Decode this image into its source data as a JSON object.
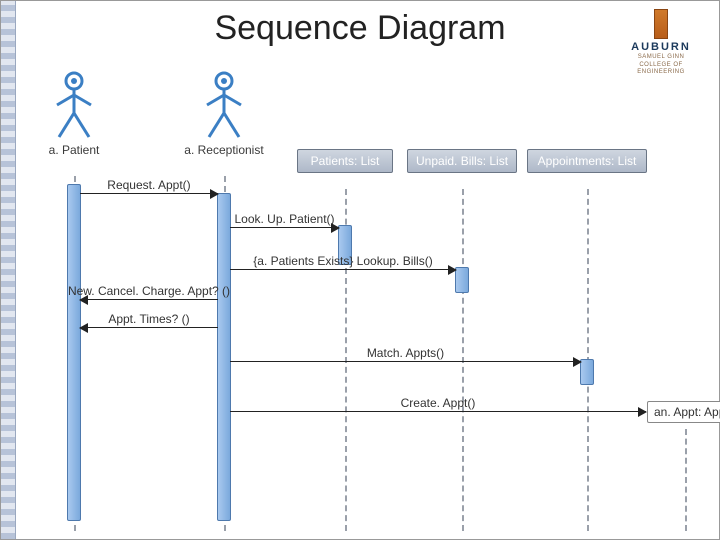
{
  "title": "Sequence Diagram",
  "logo": {
    "name": "AUBURN",
    "sub1": "SAMUEL GINN",
    "sub2": "COLLEGE OF ENGINEERING"
  },
  "actors": {
    "patient": "a. Patient",
    "receptionist": "a. Receptionist"
  },
  "objects": {
    "patients": "Patients: List",
    "bills": "Unpaid. Bills: List",
    "appts": "Appointments: List",
    "newappt": "an. Appt: Appointment"
  },
  "messages": {
    "m1": "Request. Appt()",
    "m2": "Look. Up. Patient()",
    "m3": "{a. Patients Exists} Lookup. Bills()",
    "m4": "New. Cancel. Charge. Appt? ()",
    "m5": "Appt. Times? ()",
    "m6": "Match. Appts()",
    "m7": "Create. Appt()"
  },
  "chart_data": {
    "type": "uml-sequence",
    "participants": [
      {
        "id": "patient",
        "kind": "actor",
        "label": "a. Patient"
      },
      {
        "id": "receptionist",
        "kind": "actor",
        "label": "a. Receptionist"
      },
      {
        "id": "patients",
        "kind": "object",
        "label": "Patients: List"
      },
      {
        "id": "bills",
        "kind": "object",
        "label": "Unpaid. Bills: List"
      },
      {
        "id": "appts",
        "kind": "object",
        "label": "Appointments: List"
      },
      {
        "id": "newappt",
        "kind": "object",
        "label": "an. Appt: Appointment",
        "created_by": "m7"
      }
    ],
    "messages": [
      {
        "id": "m1",
        "from": "patient",
        "to": "receptionist",
        "label": "Request. Appt()",
        "direction": "call"
      },
      {
        "id": "m2",
        "from": "receptionist",
        "to": "patients",
        "label": "Look. Up. Patient()",
        "direction": "call"
      },
      {
        "id": "m3",
        "from": "receptionist",
        "to": "bills",
        "label": "{a. Patients Exists} Lookup. Bills()",
        "direction": "call",
        "guard": "a. Patients Exists"
      },
      {
        "id": "m4",
        "from": "receptionist",
        "to": "patient",
        "label": "New. Cancel. Charge. Appt? ()",
        "direction": "return"
      },
      {
        "id": "m5",
        "from": "receptionist",
        "to": "patient",
        "label": "Appt. Times? ()",
        "direction": "return"
      },
      {
        "id": "m6",
        "from": "receptionist",
        "to": "appts",
        "label": "Match. Appts()",
        "direction": "call"
      },
      {
        "id": "m7",
        "from": "receptionist",
        "to": "newappt",
        "label": "Create. Appt()",
        "direction": "create"
      }
    ]
  }
}
